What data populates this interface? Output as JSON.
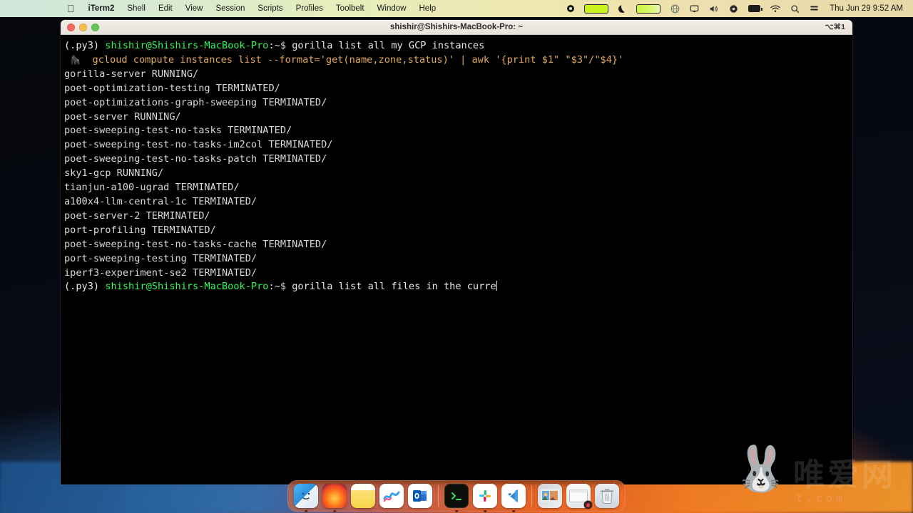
{
  "menubar": {
    "apple_icon": "apple-logo",
    "items": [
      {
        "label": "iTerm2",
        "bold": true
      },
      {
        "label": "Shell",
        "bold": false
      },
      {
        "label": "Edit",
        "bold": false
      },
      {
        "label": "View",
        "bold": false
      },
      {
        "label": "Session",
        "bold": false
      },
      {
        "label": "Scripts",
        "bold": false
      },
      {
        "label": "Profiles",
        "bold": false
      },
      {
        "label": "Toolbelt",
        "bold": false
      },
      {
        "label": "Window",
        "bold": false
      },
      {
        "label": "Help",
        "bold": false
      }
    ],
    "status_icons": [
      "record-dot-icon",
      "battery-full-green-icon",
      "moon-dnd-icon",
      "battery-green-icon",
      "globe-icon",
      "display-icon",
      "volume-icon",
      "clock-icon",
      "battery-icon",
      "wifi-icon",
      "search-icon",
      "control-center-icon"
    ],
    "datetime": "Thu Jun 29  9:52 AM"
  },
  "window": {
    "title": "shishir@Shishirs-MacBook-Pro: ~",
    "shortcut": "⌥⌘1",
    "traffic_lights": [
      "close-button",
      "minimize-button",
      "zoom-button"
    ]
  },
  "terminal": {
    "prompt_env": "(.py3)",
    "prompt_user": "shishir@Shishirs-MacBook-Pro",
    "prompt_tail": ":~$",
    "first_command": "gorilla list all my GCP instances",
    "suggestion_icon": "gorilla-icon",
    "suggested_command": "gcloud compute instances list --format='get(name,zone,status)' | awk '{print $1\" \"$3\"/\"$4}'",
    "output_lines": [
      "gorilla-server RUNNING/",
      "poet-optimization-testing TERMINATED/",
      "poet-optimizations-graph-sweeping TERMINATED/",
      "poet-server RUNNING/",
      "poet-sweeping-test-no-tasks TERMINATED/",
      "poet-sweeping-test-no-tasks-im2col TERMINATED/",
      "poet-sweeping-test-no-tasks-patch TERMINATED/",
      "sky1-gcp RUNNING/",
      "tianjun-a100-ugrad TERMINATED/",
      "a100x4-llm-central-1c TERMINATED/",
      "poet-server-2 TERMINATED/",
      "port-profiling TERMINATED/",
      "poet-sweeping-test-no-tasks-cache TERMINATED/",
      "port-sweeping-testing TERMINATED/",
      "iperf3-experiment-se2 TERMINATED/"
    ],
    "current_command": "gorilla list all files in the curre"
  },
  "watermark": {
    "bunny": "🐰",
    "text_cn": "唯爱网",
    "url": "t.com"
  },
  "dock": {
    "items": [
      {
        "name": "finder",
        "label": "Finder",
        "glyph": "",
        "running": true
      },
      {
        "name": "firefox",
        "label": "Firefox",
        "glyph": "",
        "running": true
      },
      {
        "name": "notes",
        "label": "Notes",
        "glyph": "",
        "running": false
      },
      {
        "name": "freeform",
        "label": "Freeform",
        "glyph": "〰",
        "running": false
      },
      {
        "name": "outlook",
        "label": "Outlook",
        "glyph": "O",
        "running": false
      },
      {
        "name": "iterm2",
        "label": "iTerm2",
        "glyph": ">_",
        "running": true
      },
      {
        "name": "slack",
        "label": "Slack",
        "glyph": "",
        "running": true
      },
      {
        "name": "vscode",
        "label": "Visual Studio Code",
        "glyph": "",
        "running": true
      },
      {
        "name": "photos-folder",
        "label": "Photos",
        "glyph": "",
        "running": false
      },
      {
        "name": "documents-stack",
        "label": "Documents",
        "glyph": "",
        "running": false
      },
      {
        "name": "trash",
        "label": "Trash",
        "glyph": "",
        "running": false
      }
    ]
  },
  "colors": {
    "prompt_green": "#2ef659",
    "suggestion_orange": "#e0a95f",
    "terminal_bg": "#000000",
    "output_text": "#d8d8d8"
  }
}
